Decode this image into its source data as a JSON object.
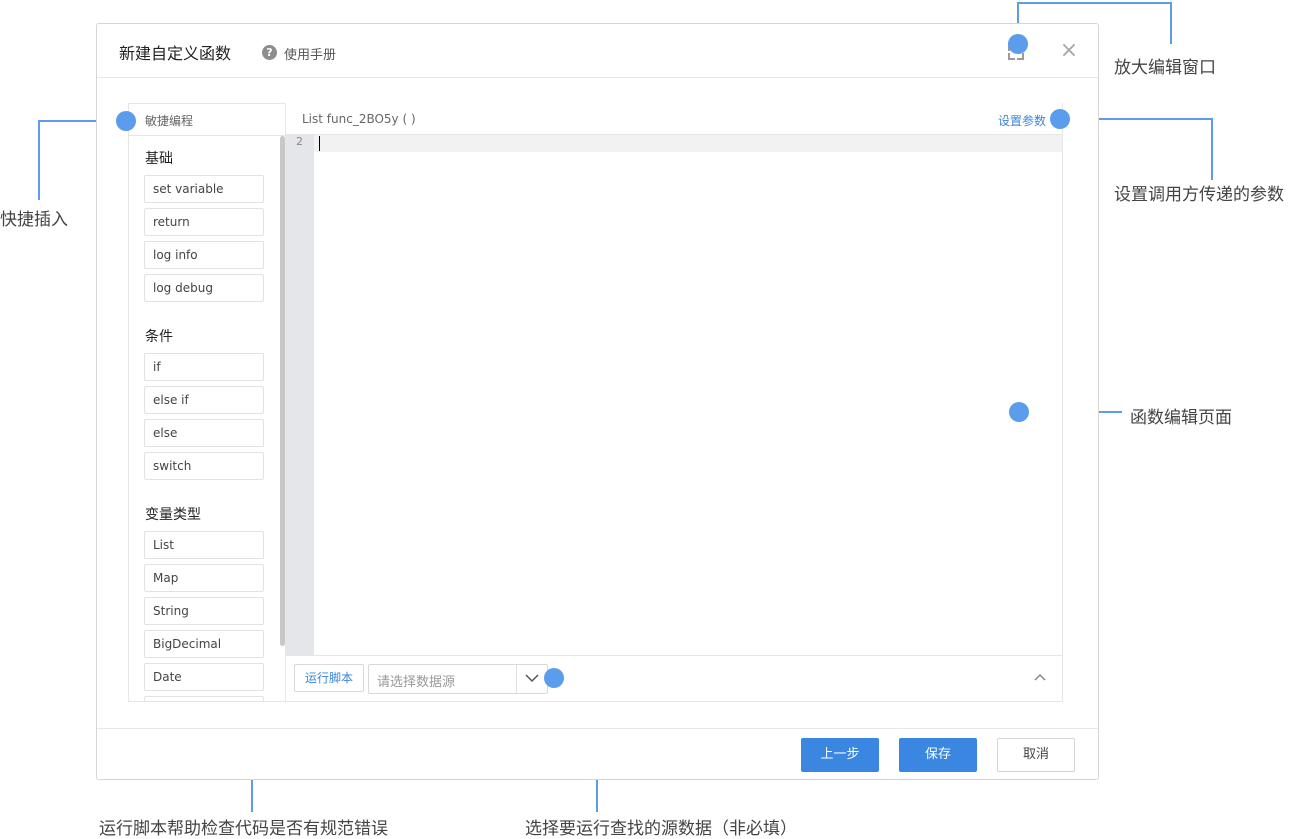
{
  "dialog": {
    "title": "新建自定义函数",
    "help_label": "使用手册",
    "help_icon": "?",
    "expand_icon": "expand-icon",
    "close_icon": "×"
  },
  "quick_insert": {
    "title": "敏捷编程",
    "groups": [
      {
        "label": "基础",
        "items": [
          "set variable",
          "return",
          "log info",
          "log debug"
        ]
      },
      {
        "label": "条件",
        "items": [
          "if",
          "else if",
          "else",
          "switch"
        ]
      },
      {
        "label": "变量类型",
        "items": [
          "List",
          "Map",
          "String",
          "BigDecimal",
          "Date"
        ]
      }
    ]
  },
  "editor": {
    "signature": "List func_2BO5y ( )",
    "set_params_label": "设置参数",
    "line_number": "2",
    "run_label": "运行脚本",
    "datasource_placeholder": "请选择数据源"
  },
  "footer": {
    "prev_label": "上一步",
    "save_label": "保存",
    "cancel_label": "取消"
  },
  "annotations": {
    "expand_window": "放大编辑窗口",
    "set_caller_params": "设置调用方传递的参数",
    "quick_insert": "快捷插入",
    "edit_page": "函数编辑页面",
    "run_script_help": "运行脚本帮助检查代码是否有规范错误",
    "select_datasource": "选择要运行查找的源数据（非必填）"
  },
  "colors": {
    "accent": "#3a86e0",
    "annotation": "#5b9cec"
  }
}
